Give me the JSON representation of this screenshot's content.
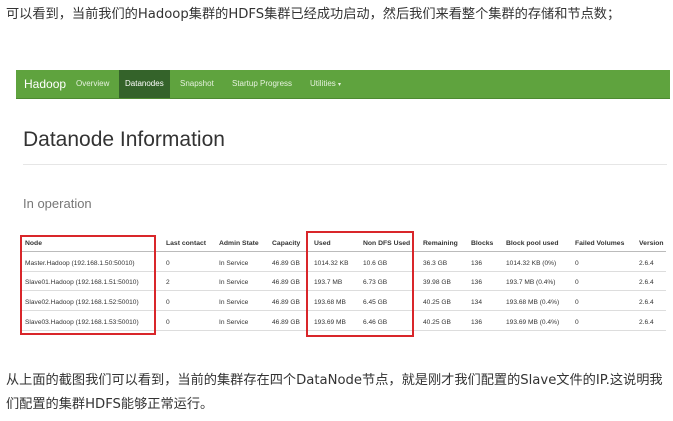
{
  "article": {
    "intro": "可以看到，当前我们的Hadoop集群的HDFS集群已经成功启动，然后我们来看整个集群的存储和节点数；",
    "conclusion": "从上面的截图我们可以看到，当前的集群存在四个DataNode节点，就是刚才我们配置的Slave文件的IP.这说明我们配置的集群HDFS能够正常运行。"
  },
  "navbar": {
    "brand": "Hadoop",
    "items": [
      "Overview",
      "Datanodes",
      "Snapshot",
      "Startup Progress",
      "Utilities"
    ],
    "active": "Datanodes",
    "colors": {
      "bar": "#5fa33e",
      "active": "#34632a"
    }
  },
  "page": {
    "title": "Datanode Information",
    "section": "In operation"
  },
  "table": {
    "headers": [
      "Node",
      "Last contact",
      "Admin State",
      "Capacity",
      "Used",
      "Non DFS Used",
      "Remaining",
      "Blocks",
      "Block pool used",
      "Failed Volumes",
      "Version"
    ],
    "rows": [
      [
        "Master.Hadoop (192.168.1.50:50010)",
        "0",
        "In Service",
        "46.89 GB",
        "1014.32 KB",
        "10.6 GB",
        "36.3 GB",
        "136",
        "1014.32 KB (0%)",
        "0",
        "2.6.4"
      ],
      [
        "Slave01.Hadoop (192.168.1.51:50010)",
        "2",
        "In Service",
        "46.89 GB",
        "193.7 MB",
        "6.73 GB",
        "39.98 GB",
        "136",
        "193.7 MB (0.4%)",
        "0",
        "2.6.4"
      ],
      [
        "Slave02.Hadoop (192.168.1.52:50010)",
        "0",
        "In Service",
        "46.89 GB",
        "193.68 MB",
        "6.45 GB",
        "40.25 GB",
        "134",
        "193.68 MB (0.4%)",
        "0",
        "2.6.4"
      ],
      [
        "Slave03.Hadoop (192.168.1.53:50010)",
        "0",
        "In Service",
        "46.89 GB",
        "193.69 MB",
        "6.46 GB",
        "40.25 GB",
        "136",
        "193.69 MB (0.4%)",
        "0",
        "2.6.4"
      ]
    ]
  },
  "highlight_color": "#d9262a"
}
